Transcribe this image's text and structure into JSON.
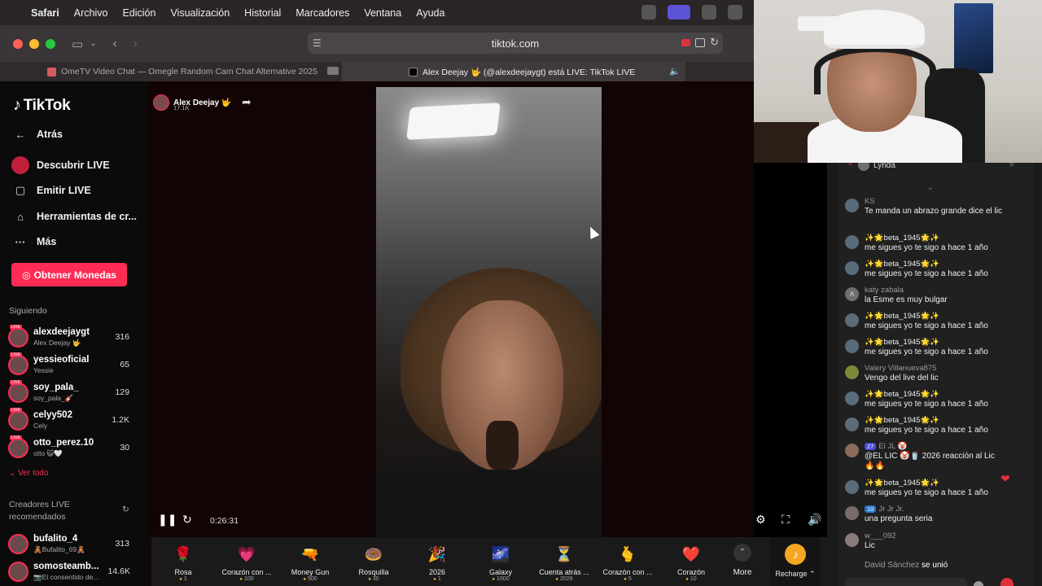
{
  "menubar": {
    "app": "Safari",
    "items": [
      "Archivo",
      "Edición",
      "Visualización",
      "Historial",
      "Marcadores",
      "Ventana",
      "Ayuda"
    ]
  },
  "toolbar": {
    "url": "tiktok.com"
  },
  "tabs": [
    {
      "title": "OmeTV Video Chat — Omegle Random Cam Chat Alternative 2025",
      "active": false
    },
    {
      "title": "Alex Deejay 🤟 (@alexdeejaygt) está LIVE: TikTok LIVE",
      "active": true
    }
  ],
  "tiktok": {
    "logo": "TikTok",
    "back": "Atrás",
    "nav": [
      "Descubrir LIVE",
      "Emitir LIVE",
      "Herramientas de cr...",
      "Más"
    ],
    "coins_button": "Obtener Monedas",
    "following_header": "Siguiendo",
    "following": [
      {
        "name": "alexdeejaygt",
        "sub": "Alex Deejay 🤟",
        "count": "316"
      },
      {
        "name": "yessieoficial",
        "sub": "Yessie",
        "count": "65"
      },
      {
        "name": "soy_pala_",
        "sub": "soy_pala_🎸",
        "count": "129"
      },
      {
        "name": "celyy502",
        "sub": "Cely",
        "count": "1.2K"
      },
      {
        "name": "otto_perez.10",
        "sub": "otto 😺🤍",
        "count": "30"
      }
    ],
    "see_all": "Ver todo",
    "recommended_header": "Creadores LIVE recomendados",
    "recommended": [
      {
        "name": "bufalito_4",
        "sub": "🧸Bufalito_69🧸",
        "count": "313"
      },
      {
        "name": "somosteamb...",
        "sub": "📷El consentido de...",
        "count": "14.6K"
      }
    ],
    "live_badge": "LIVE"
  },
  "stream": {
    "streamer": "Alex Deejay 🤟",
    "likes": "17.1K",
    "elapsed": "0:26:31"
  },
  "gifts": [
    {
      "name": "Rosa",
      "price": "1",
      "icon": "🌹"
    },
    {
      "name": "Corazón con ...",
      "price": "100",
      "icon": "💗"
    },
    {
      "name": "Money Gun",
      "price": "500",
      "icon": "🔫"
    },
    {
      "name": "Rosquilla",
      "price": "30",
      "icon": "🍩"
    },
    {
      "name": "2026",
      "price": "1",
      "icon": "🎉"
    },
    {
      "name": "Galaxy",
      "price": "1000",
      "icon": "🌌"
    },
    {
      "name": "Cuenta atrás ...",
      "price": "2026",
      "icon": "⏳"
    },
    {
      "name": "Corazón con ...",
      "price": "5",
      "icon": "🫰"
    },
    {
      "name": "Corazón",
      "price": "10",
      "icon": "❤️"
    }
  ],
  "gift_more": "More",
  "recharge": "Recharge",
  "chat": {
    "top_viewer": {
      "name": "Lynda",
      "rank": "3",
      "value": "9"
    },
    "messages": [
      {
        "user": "KS",
        "text": "Te manda un abrazo grande dice el lic",
        "avatar": ""
      },
      {
        "user": "✨🌟beta_1945🌟✨",
        "text": "me sigues yo te sigo a hace 1 año",
        "avatar": ""
      },
      {
        "user": "✨🌟beta_1945🌟✨",
        "text": "me sigues yo te sigo a hace 1 año",
        "avatar": ""
      },
      {
        "user": "katy zabala",
        "text": "la Esme es muy bulgar",
        "avatar": "A"
      },
      {
        "user": "✨🌟beta_1945🌟✨",
        "text": "me sigues yo te sigo a hace 1 año",
        "avatar": ""
      },
      {
        "user": "✨🌟beta_1945🌟✨",
        "text": "me sigues yo te sigo a hace 1 año",
        "avatar": ""
      },
      {
        "user": "Valery Villanueva875",
        "text": "Vengo del live del lic",
        "avatar": ""
      },
      {
        "user": "✨🌟beta_1945🌟✨",
        "text": "me sigues yo te sigo a hace 1 año",
        "avatar": ""
      },
      {
        "user": "✨🌟beta_1945🌟✨",
        "text": "me sigues yo te sigo a hace 1 año",
        "avatar": ""
      },
      {
        "user": "El JL 🤡",
        "badge": "27",
        "text": "@EL LIC 🤡🥤 2026 reacción al Lic 🔥🔥",
        "avatar": ""
      },
      {
        "user": "✨🌟beta_1945🌟✨",
        "text": "me sigues yo te sigo a hace 1 año",
        "avatar": ""
      },
      {
        "user": "Jr Jr Jr.",
        "badge": "10",
        "text": "una pregunta seria",
        "avatar": ""
      },
      {
        "user": "w___092",
        "text": "Lic",
        "avatar": ""
      }
    ],
    "joined_user": "David Sánchez",
    "joined_text": "se unió"
  }
}
